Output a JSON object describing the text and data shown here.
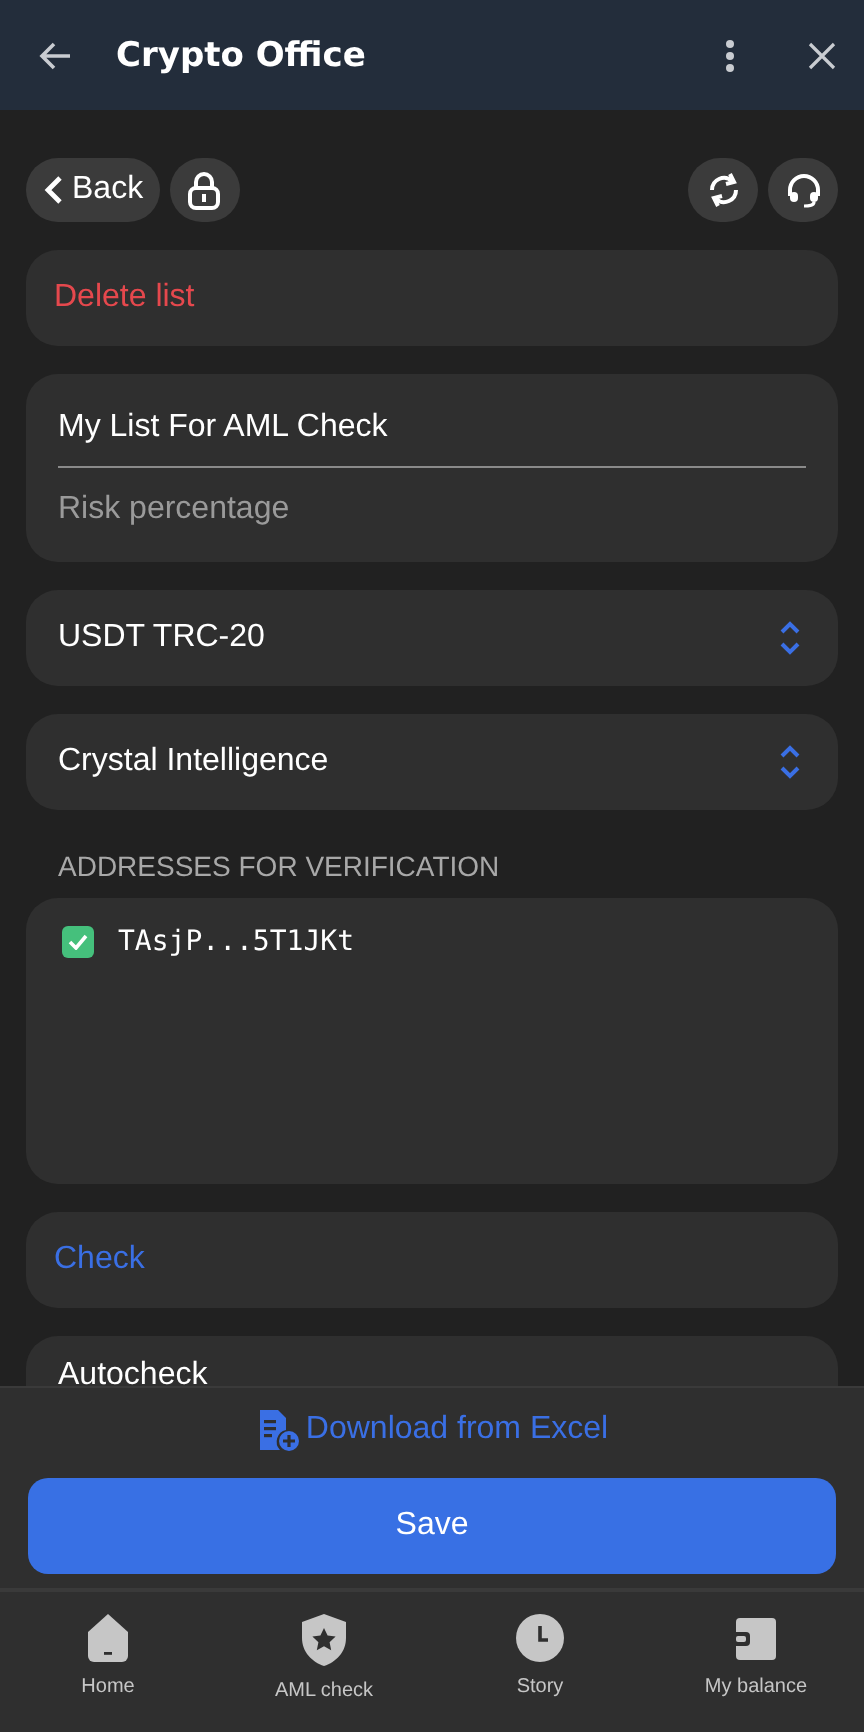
{
  "window": {
    "title": "Crypto Office"
  },
  "toolbar": {
    "back": "Back"
  },
  "delete_action": "Delete list",
  "list_form": {
    "name_value": "My List For AML Check",
    "risk_placeholder": "Risk percentage"
  },
  "selects": [
    {
      "value": "USDT TRC-20"
    },
    {
      "value": "Crystal Intelligence"
    }
  ],
  "addresses": {
    "heading": "ADDRESSES FOR VERIFICATION",
    "items": [
      {
        "address": "TAsjP...5T1JKt",
        "checked": true
      }
    ]
  },
  "check_action": "Check",
  "autocheck": {
    "label": "Autocheck"
  },
  "download_link": "Download from Excel",
  "save_button": "Save",
  "nav": [
    {
      "kind": "home",
      "label": "Home"
    },
    {
      "kind": "shield",
      "label": "AML check"
    },
    {
      "kind": "clock",
      "label": "Story"
    },
    {
      "kind": "wallet",
      "label": "My balance"
    }
  ]
}
